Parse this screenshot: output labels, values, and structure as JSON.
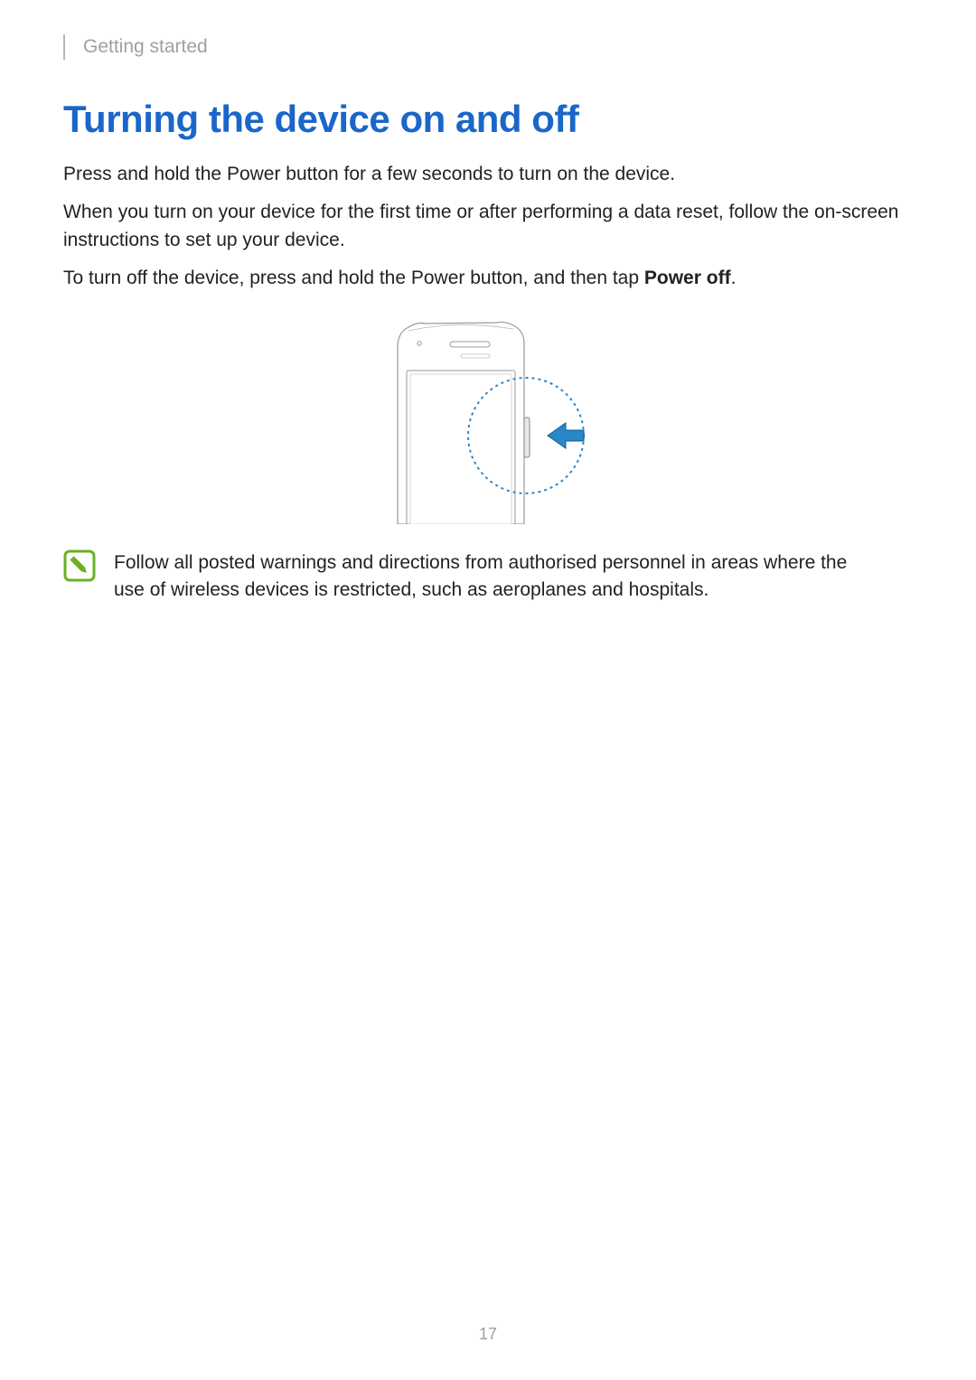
{
  "header": {
    "section": "Getting started"
  },
  "title": "Turning the device on and off",
  "paragraphs": {
    "p1": "Press and hold the Power button for a few seconds to turn on the device.",
    "p2": "When you turn on your device for the first time or after performing a data reset, follow the on-screen instructions to set up your device.",
    "p3_pre": "To turn off the device, press and hold the Power button, and then tap ",
    "p3_bold": "Power off",
    "p3_post": "."
  },
  "note": {
    "icon_name": "note-icon",
    "text": "Follow all posted warnings and directions from authorised personnel in areas where the use of wireless devices is restricted, such as aeroplanes and hospitals."
  },
  "page_number": "17"
}
